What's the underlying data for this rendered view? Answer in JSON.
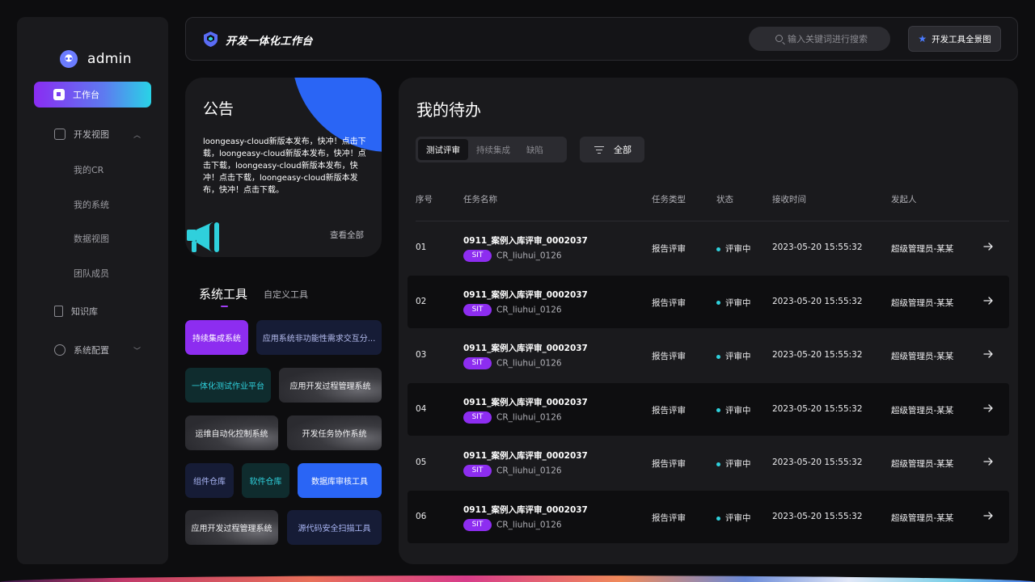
{
  "brand": {
    "name": "admin"
  },
  "header": {
    "title": "开发一体化工作台",
    "search_placeholder": "输入关键词进行搜索",
    "map_button": "开发工具全景图"
  },
  "sidebar": {
    "items": [
      {
        "label": "工作台",
        "active": true
      },
      {
        "label": "开发视图"
      },
      {
        "label": "我的CR"
      },
      {
        "label": "我的系统"
      },
      {
        "label": "数据视图"
      },
      {
        "label": "团队成员"
      },
      {
        "label": "知识库"
      },
      {
        "label": "系统配置"
      }
    ]
  },
  "notice": {
    "title": "公告",
    "body": "loongeasy-cloud新版本发布，快冲！点击下载，loongeasy-cloud新版本发布，快冲！点击下载，loongeasy-cloud新版本发布，快冲！点击下载，loongeasy-cloud新版本发布，快冲！点击下载。",
    "more": "查看全部"
  },
  "tools": {
    "tabs": [
      "系统工具",
      "自定义工具"
    ],
    "items": [
      "持续集成系统",
      "应用系统非功能性需求交互分...",
      "一体化测试作业平台",
      "应用开发过程管理系统",
      "运维自动化控制系统",
      "开发任务协作系统",
      "组件仓库",
      "软件仓库",
      "数据库审核工具",
      "应用开发过程管理系统",
      "源代码安全扫描工具"
    ]
  },
  "todo": {
    "title": "我的待办",
    "tabs": [
      "测试评审",
      "持续集成",
      "缺陷"
    ],
    "filter": "全部",
    "columns": [
      "序号",
      "任务名称",
      "任务类型",
      "状态",
      "接收时间",
      "发起人"
    ],
    "rows": [
      {
        "no": "01",
        "name": "0911_案例入库评审_0002037",
        "tag": "SIT",
        "cr": "CR_liuhui_0126",
        "type": "报告评审",
        "status": "评审中",
        "time": "2023-05-20 15:55:32",
        "owner": "超级管理员-某某"
      },
      {
        "no": "02",
        "name": "0911_案例入库评审_0002037",
        "tag": "SIT",
        "cr": "CR_liuhui_0126",
        "type": "报告评审",
        "status": "评审中",
        "time": "2023-05-20 15:55:32",
        "owner": "超级管理员-某某"
      },
      {
        "no": "03",
        "name": "0911_案例入库评审_0002037",
        "tag": "SIT",
        "cr": "CR_liuhui_0126",
        "type": "报告评审",
        "status": "评审中",
        "time": "2023-05-20 15:55:32",
        "owner": "超级管理员-某某"
      },
      {
        "no": "04",
        "name": "0911_案例入库评审_0002037",
        "tag": "SIT",
        "cr": "CR_liuhui_0126",
        "type": "报告评审",
        "status": "评审中",
        "time": "2023-05-20 15:55:32",
        "owner": "超级管理员-某某"
      },
      {
        "no": "05",
        "name": "0911_案例入库评审_0002037",
        "tag": "SIT",
        "cr": "CR_liuhui_0126",
        "type": "报告评审",
        "status": "评审中",
        "time": "2023-05-20 15:55:32",
        "owner": "超级管理员-某某"
      },
      {
        "no": "06",
        "name": "0911_案例入库评审_0002037",
        "tag": "SIT",
        "cr": "CR_liuhui_0126",
        "type": "报告评审",
        "status": "评审中",
        "time": "2023-05-20 15:55:32",
        "owner": "超级管理员-某某"
      }
    ]
  },
  "colors": {
    "accent_purple": "#8d2df0",
    "accent_blue": "#2a65f5",
    "accent_cyan": "#2fd0dc"
  }
}
